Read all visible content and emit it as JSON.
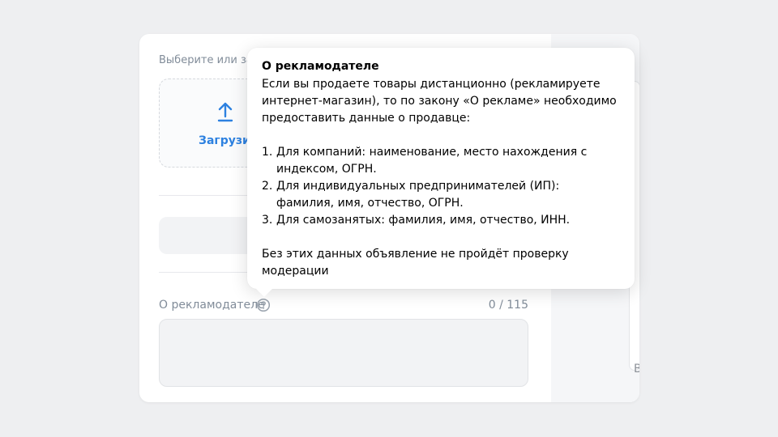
{
  "form": {
    "section_label": "Выберите или за",
    "upload": {
      "label": "Загрузит",
      "icon": "upload-icon"
    },
    "advertiser_field": {
      "label": "О рекламодателе",
      "help_icon": "question-circle-icon",
      "counter": "0 / 115",
      "value": ""
    }
  },
  "right_pane": {
    "cut_text": "В"
  },
  "tooltip": {
    "title": "О рекламодателе",
    "intro": "Если вы продаете товары дистанционно (рекламируете интернет-магазин), то по закону «О рекламе» необходимо предоставить данные о продавце:",
    "items": [
      {
        "num": "1.",
        "text": "Для компаний: наименование, место нахождения с индексом, ОГРН."
      },
      {
        "num": "2.",
        "text": "Для индивидуальных предпринимателей (ИП): фамилия, имя, отчество, ОГРН."
      },
      {
        "num": "3.",
        "text": "Для самозанятых: фамилия, имя, отчество, ИНН."
      }
    ],
    "footer": "Без этих данных объявление не пройдёт проверку модерации"
  },
  "colors": {
    "accent": "#2d81e0",
    "muted_text": "#818c99",
    "page_bg": "#eeeff1",
    "field_bg": "#f2f3f5"
  }
}
